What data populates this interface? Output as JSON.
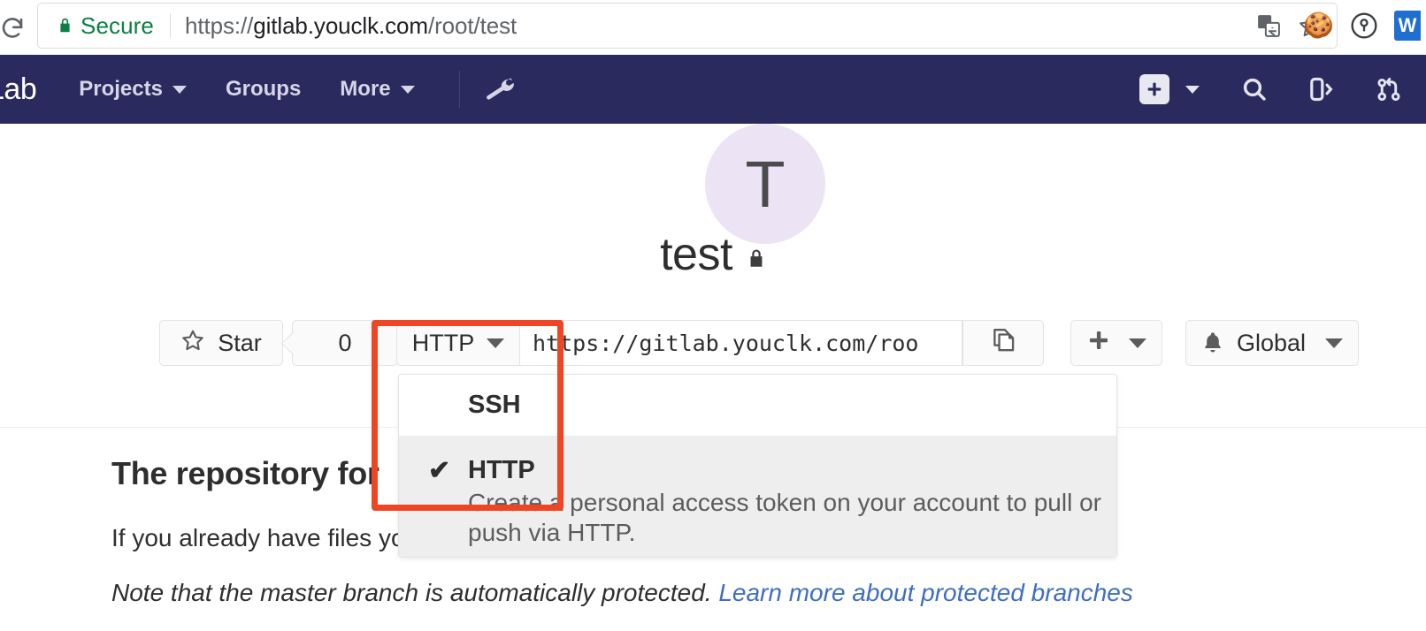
{
  "browser": {
    "reload_icon": "reload-icon",
    "security_label": "Secure",
    "lock_icon": "lock-icon",
    "url_scheme": "https://",
    "url_origin": "gitlab.youclk.com",
    "url_path": "/root/test",
    "translate_icon": "translate-icon",
    "bookmark_icon": "star-outline-icon",
    "extensions": [
      {
        "name": "cookie-extension-icon",
        "glyph": "🍪"
      },
      {
        "name": "password-key-extension-icon",
        "glyph": "key"
      },
      {
        "name": "blue-w-extension-icon",
        "glyph": "W"
      }
    ]
  },
  "navbar": {
    "brand": "Lab",
    "links": [
      {
        "label": "Projects",
        "has_caret": true
      },
      {
        "label": "Groups",
        "has_caret": false
      },
      {
        "label": "More",
        "has_caret": true
      }
    ],
    "admin_icon": "wrench-icon",
    "right_icons": [
      {
        "name": "new-plus-icon"
      },
      {
        "name": "new-dropdown-caret-icon"
      },
      {
        "name": "search-icon"
      },
      {
        "name": "issues-icon"
      },
      {
        "name": "merge-requests-icon"
      }
    ]
  },
  "project": {
    "avatar_initial": "T",
    "name": "test",
    "visibility_icon": "lock-icon"
  },
  "toolbar": {
    "star_label": "Star",
    "star_icon": "star-outline-icon",
    "star_count": "0",
    "clone_protocol": "HTTP",
    "clone_url": "https://gitlab.youclk.com/roo",
    "copy_icon": "copy-to-clipboard-icon",
    "plus_icon": "plus-icon",
    "notification_icon": "bell-icon",
    "notification_label": "Global"
  },
  "clone_dropdown": {
    "options": [
      {
        "label": "SSH",
        "checked": false,
        "description": ""
      },
      {
        "label": "HTTP",
        "checked": true,
        "check_glyph": "✔",
        "description": "Create a personal access token on your account to pull or push via HTTP."
      }
    ]
  },
  "content": {
    "heading": "The repository for",
    "paragraph": "If you already have files yo",
    "note_text": "Note that the master branch is automatically protected. ",
    "note_link": "Learn more about protected branches"
  },
  "annotation": {
    "highlight_color": "#ef4524",
    "target": "clone-protocol-dropdown"
  }
}
